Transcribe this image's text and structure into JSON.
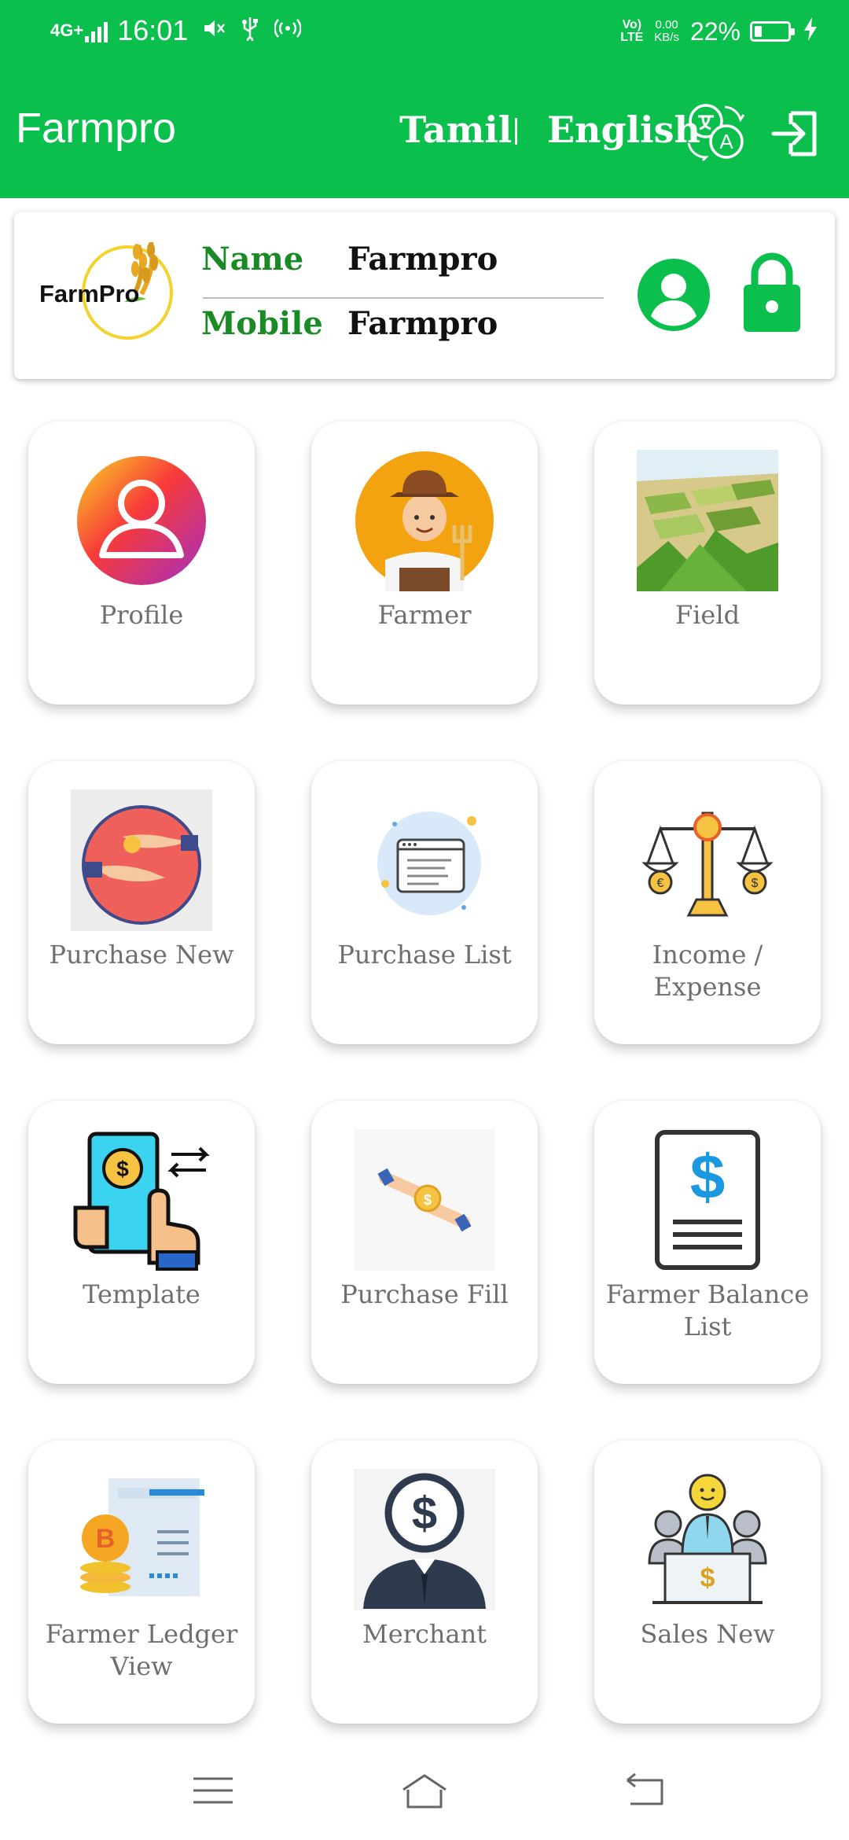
{
  "status_bar": {
    "network": "4G+",
    "time": "16:01",
    "volte_line1": "Vo)",
    "volte_line2": "LTE",
    "speed_value": "0.00",
    "speed_unit": "KB/s",
    "battery_percent": "22%",
    "battery_level": 0.22,
    "icons": [
      "signal-icon",
      "mute-icon",
      "usb-icon",
      "hotspot-icon",
      "battery-icon",
      "charging-icon"
    ]
  },
  "app_bar": {
    "title": "Farmpro",
    "lang_tamil": "Tamil",
    "lang_english": "English",
    "icons": [
      "translate-icon",
      "logout-icon"
    ],
    "color": "#0bbf4d"
  },
  "user_card": {
    "logo_text": "FarmPro",
    "name_label": "Name",
    "name_value": "Farmpro",
    "mobile_label": "Mobile",
    "mobile_value": "Farmpro",
    "icons": [
      "profile-avatar-icon",
      "lock-icon"
    ]
  },
  "menu": {
    "items": [
      {
        "label": "Profile",
        "icon": "profile-icon"
      },
      {
        "label": "Farmer",
        "icon": "farmer-icon"
      },
      {
        "label": "Field",
        "icon": "field-icon"
      },
      {
        "label": "Purchase New",
        "icon": "purchase-new-icon"
      },
      {
        "label": "Purchase List",
        "icon": "purchase-list-icon"
      },
      {
        "label": "Income / Expense",
        "icon": "income-expense-icon"
      },
      {
        "label": "Template",
        "icon": "template-icon"
      },
      {
        "label": "Purchase Fill",
        "icon": "purchase-fill-icon"
      },
      {
        "label": "Farmer Balance List",
        "icon": "balance-list-icon"
      },
      {
        "label": "Farmer Ledger View",
        "icon": "ledger-icon"
      },
      {
        "label": "Merchant",
        "icon": "merchant-icon"
      },
      {
        "label": "Sales New",
        "icon": "sales-icon"
      }
    ]
  },
  "nav_bar": {
    "icons": [
      "menu-icon",
      "home-icon",
      "back-icon"
    ]
  }
}
